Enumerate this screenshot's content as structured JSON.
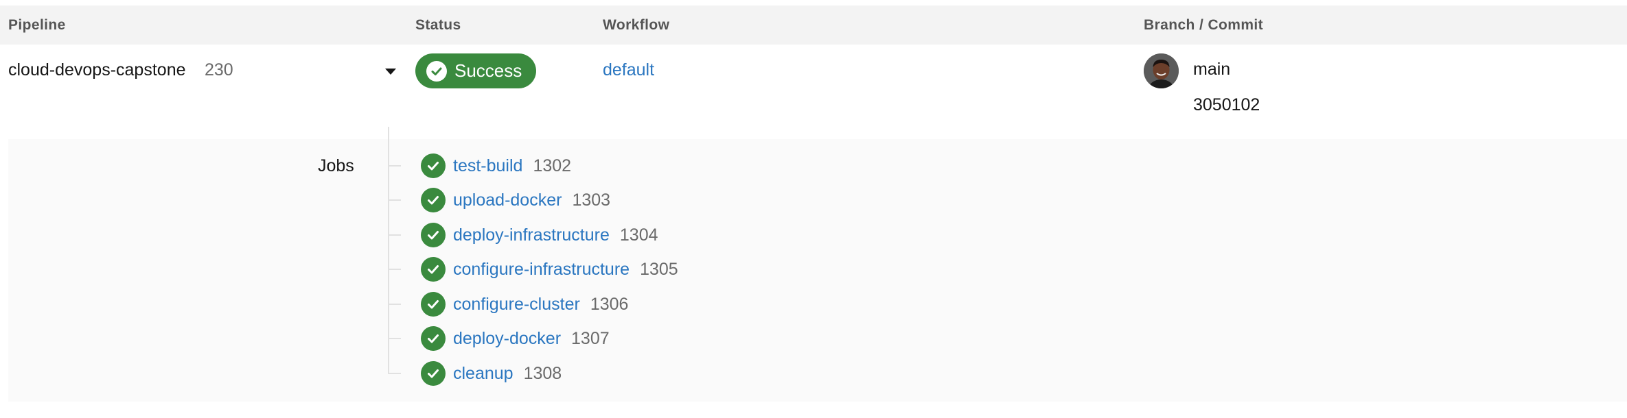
{
  "header": {
    "pipeline": "Pipeline",
    "status": "Status",
    "workflow": "Workflow",
    "branch_commit": "Branch / Commit"
  },
  "pipeline": {
    "name": "cloud-devops-capstone",
    "number": "230",
    "status": "Success",
    "workflow": "default",
    "branch": "main",
    "commit": "3050102"
  },
  "jobs": {
    "label": "Jobs",
    "items": [
      {
        "name": "test-build",
        "number": "1302"
      },
      {
        "name": "upload-docker",
        "number": "1303"
      },
      {
        "name": "deploy-infrastructure",
        "number": "1304"
      },
      {
        "name": "configure-infrastructure",
        "number": "1305"
      },
      {
        "name": "configure-cluster",
        "number": "1306"
      },
      {
        "name": "deploy-docker",
        "number": "1307"
      },
      {
        "name": "cleanup",
        "number": "1308"
      }
    ]
  },
  "icons": {
    "caret": "chevron-down-icon",
    "status": "check-circle-icon",
    "job": "check-circle-icon",
    "avatar": "user-avatar"
  },
  "colors": {
    "success": "#3a8a3e",
    "link": "#2a76c0",
    "header_bg": "#f3f3f3",
    "jobs_bg": "#fafafa"
  }
}
